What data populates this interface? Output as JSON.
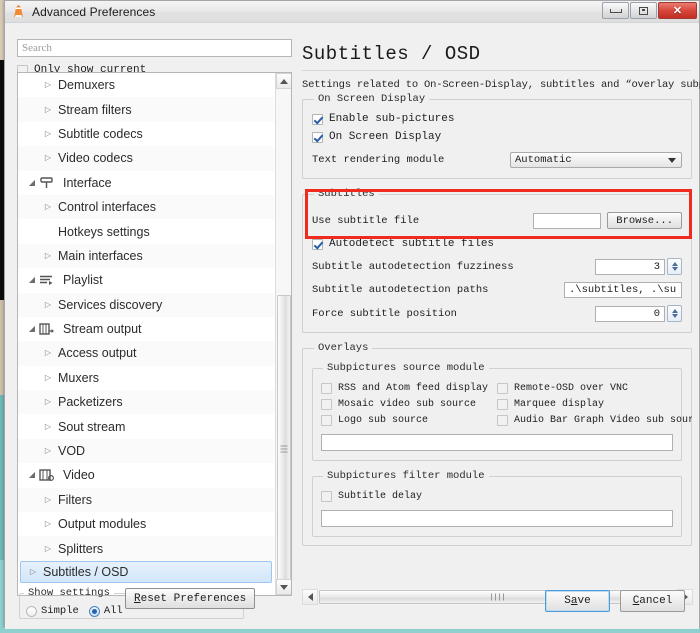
{
  "window": {
    "title": "Advanced Preferences",
    "app_icon": "vlc-cone-icon",
    "buttons": {
      "minimize": "minimize-icon",
      "maximize": "maximize-icon",
      "close": "✕"
    }
  },
  "sidebar": {
    "search": {
      "placeholder": "Search",
      "value": ""
    },
    "only_show_current": {
      "label": "Only show current",
      "checked": false
    },
    "tree": [
      {
        "label": "Demuxers",
        "level": 2,
        "arrow": "collapsed",
        "icon": null
      },
      {
        "label": "Stream filters",
        "level": 2,
        "arrow": "collapsed",
        "icon": null
      },
      {
        "label": "Subtitle codecs",
        "level": 2,
        "arrow": "collapsed",
        "icon": null
      },
      {
        "label": "Video codecs",
        "level": 2,
        "arrow": "collapsed",
        "icon": null
      },
      {
        "label": "Interface",
        "level": 1,
        "arrow": "expanded",
        "icon": "interface-icon"
      },
      {
        "label": "Control interfaces",
        "level": 2,
        "arrow": "collapsed",
        "icon": null
      },
      {
        "label": "Hotkeys settings",
        "level": 2,
        "arrow": "none",
        "icon": null
      },
      {
        "label": "Main interfaces",
        "level": 2,
        "arrow": "collapsed",
        "icon": null
      },
      {
        "label": "Playlist",
        "level": 1,
        "arrow": "expanded",
        "icon": "playlist-icon"
      },
      {
        "label": "Services discovery",
        "level": 2,
        "arrow": "collapsed",
        "icon": null
      },
      {
        "label": "Stream output",
        "level": 1,
        "arrow": "expanded",
        "icon": "stream-output-icon"
      },
      {
        "label": "Access output",
        "level": 2,
        "arrow": "collapsed",
        "icon": null
      },
      {
        "label": "Muxers",
        "level": 2,
        "arrow": "collapsed",
        "icon": null
      },
      {
        "label": "Packetizers",
        "level": 2,
        "arrow": "collapsed",
        "icon": null
      },
      {
        "label": "Sout stream",
        "level": 2,
        "arrow": "collapsed",
        "icon": null
      },
      {
        "label": "VOD",
        "level": 2,
        "arrow": "collapsed",
        "icon": null
      },
      {
        "label": "Video",
        "level": 1,
        "arrow": "expanded",
        "icon": "video-icon"
      },
      {
        "label": "Filters",
        "level": 2,
        "arrow": "collapsed",
        "icon": null
      },
      {
        "label": "Output modules",
        "level": 2,
        "arrow": "collapsed",
        "icon": null
      },
      {
        "label": "Splitters",
        "level": 2,
        "arrow": "collapsed",
        "icon": null
      },
      {
        "label": "Subtitles / OSD",
        "level": 2,
        "arrow": "collapsed",
        "icon": null,
        "selected": true
      }
    ]
  },
  "main": {
    "title": "Subtitles / OSD",
    "description": "Settings related to On-Screen-Display, subtitles and “overlay subpictures”",
    "osd_group": {
      "legend": "On Screen Display",
      "enable_subpictures": {
        "label": "Enable sub-pictures",
        "checked": true
      },
      "on_screen_display": {
        "label": "On Screen Display",
        "checked": true
      },
      "text_rendering_module": {
        "label": "Text rendering module",
        "value": "Automatic"
      }
    },
    "subtitles_group": {
      "legend": "Subtitles",
      "use_subtitle_file": {
        "label": "Use subtitle file",
        "value": ""
      },
      "browse_button": "Browse...",
      "autodetect": {
        "label": "Autodetect subtitle files",
        "checked": true
      },
      "fuzziness": {
        "label": "Subtitle autodetection fuzziness",
        "value": "3"
      },
      "paths": {
        "label": "Subtitle autodetection paths",
        "value": ".\\subtitles, .\\subs"
      },
      "force_position": {
        "label": "Force subtitle position",
        "value": "0"
      }
    },
    "overlays_group": {
      "legend": "Overlays",
      "source_module": {
        "legend": "Subpictures source module",
        "checkboxes": [
          {
            "label": "RSS and Atom feed display",
            "checked": false
          },
          {
            "label": "Remote-OSD over VNC",
            "checked": false
          },
          {
            "label": "Mosaic video sub source",
            "checked": false
          },
          {
            "label": "Marquee display",
            "checked": false
          },
          {
            "label": "Logo sub source",
            "checked": false
          },
          {
            "label": "Audio Bar Graph Video sub source",
            "checked": false
          }
        ],
        "value_field": ""
      },
      "filter_module": {
        "legend": "Subpictures filter module",
        "checkboxes": [
          {
            "label": "Subtitle delay",
            "checked": false
          }
        ],
        "value_field": ""
      }
    },
    "highlight_color": "#ee2b1c"
  },
  "footer": {
    "show_settings": {
      "legend": "Show settings",
      "simple": {
        "label": "Simple",
        "selected": false
      },
      "all": {
        "label": "All",
        "selected": true
      }
    },
    "reset_button": "Reset Preferences",
    "save_button": "Save",
    "cancel_button": "Cancel"
  }
}
